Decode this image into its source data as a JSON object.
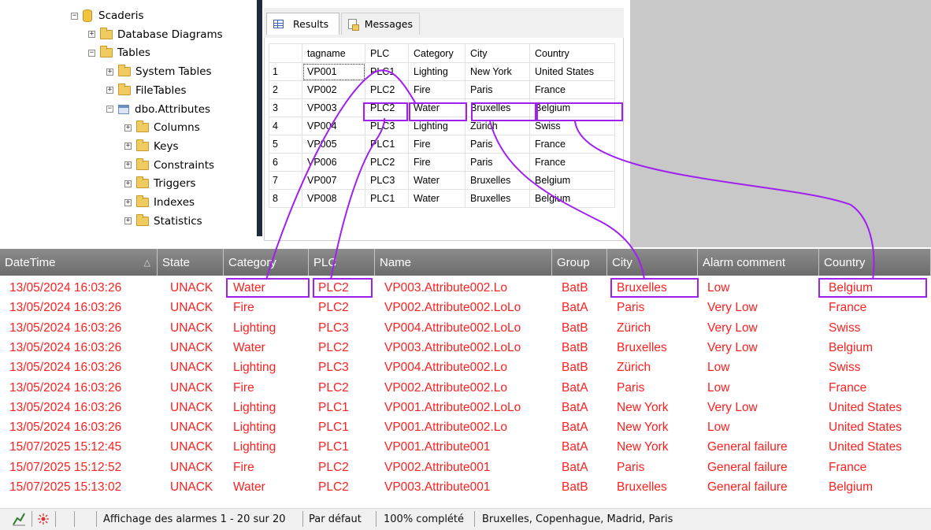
{
  "tree": {
    "items": [
      {
        "label": "Scaderis",
        "toggle": "−",
        "icon": "database-icon"
      },
      {
        "label": "Database Diagrams",
        "toggle": "+",
        "icon": "folder-icon"
      },
      {
        "label": "Tables",
        "toggle": "−",
        "icon": "folder-icon"
      },
      {
        "label": "System Tables",
        "toggle": "+",
        "icon": "folder-icon"
      },
      {
        "label": "FileTables",
        "toggle": "+",
        "icon": "folder-icon"
      },
      {
        "label": "dbo.Attributes",
        "toggle": "−",
        "icon": "table-icon"
      },
      {
        "label": "Columns",
        "toggle": "+",
        "icon": "folder-icon"
      },
      {
        "label": "Keys",
        "toggle": "+",
        "icon": "folder-icon"
      },
      {
        "label": "Constraints",
        "toggle": "+",
        "icon": "folder-icon"
      },
      {
        "label": "Triggers",
        "toggle": "+",
        "icon": "folder-icon"
      },
      {
        "label": "Indexes",
        "toggle": "+",
        "icon": "folder-icon"
      },
      {
        "label": "Statistics",
        "toggle": "+",
        "icon": "folder-icon"
      }
    ]
  },
  "results": {
    "tabs": [
      {
        "label": "Results",
        "icon": "grid-icon"
      },
      {
        "label": "Messages",
        "icon": "messages-icon"
      }
    ],
    "columns": [
      "tagname",
      "PLC",
      "Category",
      "City",
      "Country"
    ],
    "rows": [
      {
        "n": "1",
        "cells": [
          "VP001",
          "PLC1",
          "Lighting",
          "New York",
          "United States"
        ]
      },
      {
        "n": "2",
        "cells": [
          "VP002",
          "PLC2",
          "Fire",
          "Paris",
          "France"
        ]
      },
      {
        "n": "3",
        "cells": [
          "VP003",
          "PLC2",
          "Water",
          "Bruxelles",
          "Belgium"
        ]
      },
      {
        "n": "4",
        "cells": [
          "VP004",
          "PLC3",
          "Lighting",
          "Zürich",
          "Swiss"
        ]
      },
      {
        "n": "5",
        "cells": [
          "VP005",
          "PLC1",
          "Fire",
          "Paris",
          "France"
        ]
      },
      {
        "n": "6",
        "cells": [
          "VP006",
          "PLC2",
          "Fire",
          "Paris",
          "France"
        ]
      },
      {
        "n": "7",
        "cells": [
          "VP007",
          "PLC3",
          "Water",
          "Bruxelles",
          "Belgium"
        ]
      },
      {
        "n": "8",
        "cells": [
          "VP008",
          "PLC1",
          "Water",
          "Bruxelles",
          "Belgium"
        ]
      }
    ]
  },
  "alarms": {
    "columns": [
      "DateTime",
      "State",
      "Category",
      "PLC",
      "Name",
      "Group",
      "City",
      "Alarm comment",
      "Country"
    ],
    "sort_indicator": "△",
    "rows": [
      [
        "13/05/2024 16:03:26",
        "UNACK",
        "Water",
        "PLC2",
        "VP003.Attribute002.Lo",
        "BatB",
        "Bruxelles",
        "Low",
        "Belgium"
      ],
      [
        "13/05/2024 16:03:26",
        "UNACK",
        "Fire",
        "PLC2",
        "VP002.Attribute002.LoLo",
        "BatA",
        "Paris",
        "Very Low",
        "France"
      ],
      [
        "13/05/2024 16:03:26",
        "UNACK",
        "Lighting",
        "PLC3",
        "VP004.Attribute002.LoLo",
        "BatB",
        "Zürich",
        "Very Low",
        "Swiss"
      ],
      [
        "13/05/2024 16:03:26",
        "UNACK",
        "Water",
        "PLC2",
        "VP003.Attribute002.LoLo",
        "BatB",
        "Bruxelles",
        "Very Low",
        "Belgium"
      ],
      [
        "13/05/2024 16:03:26",
        "UNACK",
        "Lighting",
        "PLC3",
        "VP004.Attribute002.Lo",
        "BatB",
        "Zürich",
        "Low",
        "Swiss"
      ],
      [
        "13/05/2024 16:03:26",
        "UNACK",
        "Fire",
        "PLC2",
        "VP002.Attribute002.Lo",
        "BatA",
        "Paris",
        "Low",
        "France"
      ],
      [
        "13/05/2024 16:03:26",
        "UNACK",
        "Lighting",
        "PLC1",
        "VP001.Attribute002.LoLo",
        "BatA",
        "New York",
        "Very Low",
        "United States"
      ],
      [
        "13/05/2024 16:03:26",
        "UNACK",
        "Lighting",
        "PLC1",
        "VP001.Attribute002.Lo",
        "BatA",
        "New York",
        "Low",
        "United States"
      ],
      [
        "15/07/2025 15:12:45",
        "UNACK",
        "Lighting",
        "PLC1",
        "VP001.Attribute001",
        "BatA",
        "New York",
        "General failure",
        "United States"
      ],
      [
        "15/07/2025 15:12:52",
        "UNACK",
        "Fire",
        "PLC2",
        "VP002.Attribute001",
        "BatA",
        "Paris",
        "General failure",
        "France"
      ],
      [
        "15/07/2025 15:13:02",
        "UNACK",
        "Water",
        "PLC2",
        "VP003.Attribute001",
        "BatB",
        "Bruxelles",
        "General failure",
        "Belgium"
      ]
    ]
  },
  "statusbar": {
    "icons": [
      "chart-icon",
      "alarm-icon"
    ],
    "display": "Affichage des alarmes 1 - 20 sur 20",
    "filter": "Par défaut",
    "progress": "100% complété",
    "cities": "Bruxelles, Copenhague, Madrid, Paris"
  },
  "colors": {
    "alarm_text": "#ff1f1f",
    "highlight": "#a020f0",
    "header_bg": "#7c7c7c"
  }
}
